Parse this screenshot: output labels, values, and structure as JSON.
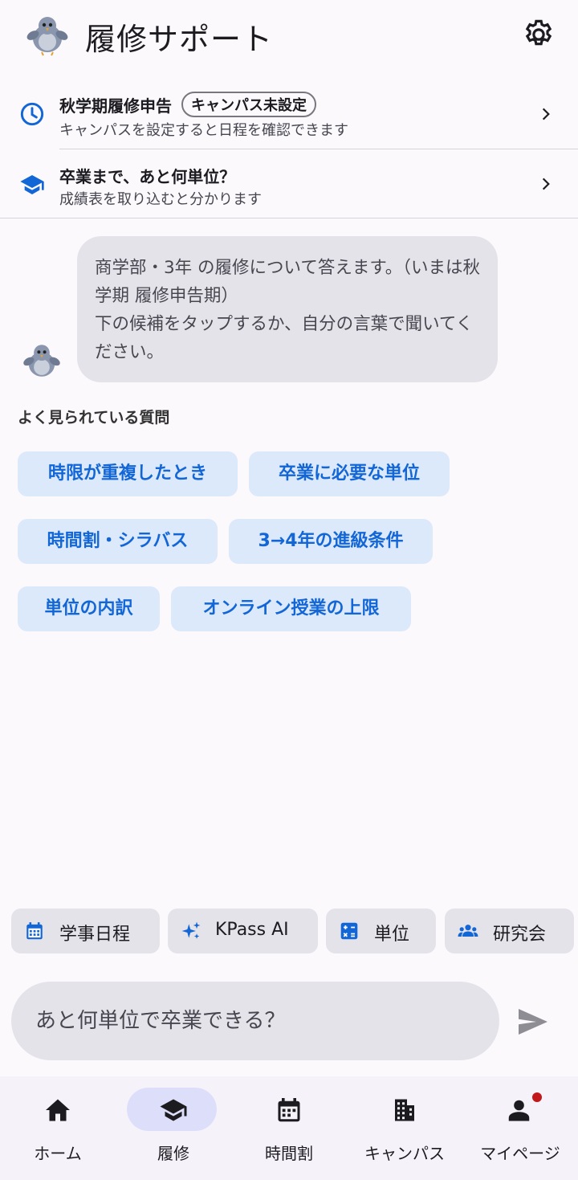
{
  "app": {
    "title": "履修サポート"
  },
  "info": {
    "semester": {
      "title": "秋学期履修申告",
      "badge": "キャンパス未設定",
      "subtitle": "キャンパスを設定すると日程を確認できます"
    },
    "graduation": {
      "title": "卒業まで、あと何単位？",
      "subtitle": "成績表を取り込むと分かります"
    }
  },
  "chat": {
    "message": "商学部・3年 の履修について答えます。（いまは秋学期 履修申告期）\n下の候補をタップするか、自分の言葉で聞いてください。"
  },
  "faq": {
    "label": "よく見られている質問",
    "chips": [
      "時限が重複したとき",
      "卒業に必要な単位",
      "時間割・シラバス",
      "3→4年の進級条件",
      "単位の内訳",
      "オンライン授業の上限"
    ]
  },
  "actions": [
    {
      "label": "学事日程",
      "icon": "calendar-icon"
    },
    {
      "label": "KPass AI",
      "icon": "sparkle-icon"
    },
    {
      "label": "単位",
      "icon": "calculator-icon"
    },
    {
      "label": "研究会",
      "icon": "groups-icon"
    }
  ],
  "input": {
    "placeholder": "あと何単位で卒業できる？"
  },
  "nav": {
    "items": [
      {
        "label": "ホーム",
        "icon": "home-icon"
      },
      {
        "label": "履修",
        "icon": "graduation-cap-icon",
        "active": true
      },
      {
        "label": "時間割",
        "icon": "calendar-icon"
      },
      {
        "label": "キャンパス",
        "icon": "building-icon"
      },
      {
        "label": "マイページ",
        "icon": "person-icon",
        "notification": true
      }
    ]
  },
  "colors": {
    "accent": "#1266d6",
    "chip_bg": "#dce9fb",
    "bubble_bg": "#e5e3ea",
    "nav_active": "#dddffa",
    "notification": "#c3181b"
  }
}
